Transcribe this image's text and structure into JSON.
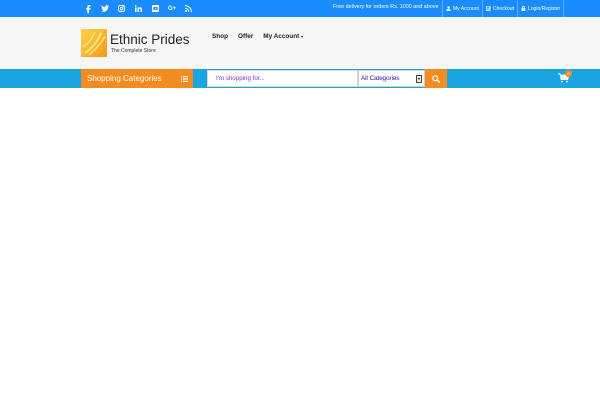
{
  "colors": {
    "topbar": "#1a8cff",
    "header_bg": "#f6f6f6",
    "category_bar": "#1aa4e2",
    "accent_orange": "#f48b20"
  },
  "topbar": {
    "social_icons": [
      "facebook-icon",
      "twitter-icon",
      "instagram-icon",
      "linkedin-icon",
      "youtube-icon",
      "google-plus-icon",
      "rss-icon"
    ],
    "google_plus_label": "G+",
    "promo": "Free delivery for orders Rs. 1000 and above",
    "links": [
      {
        "label": "My Account",
        "icon": "user-icon"
      },
      {
        "label": "Checkout",
        "icon": "checkbox-icon"
      },
      {
        "label": "Login/Register",
        "icon": "lock-icon"
      }
    ]
  },
  "header": {
    "logo_title": "Ethnic Prides",
    "logo_subtitle": "The Complete Store",
    "nav": [
      {
        "label": "Shop"
      },
      {
        "label": "Offer"
      },
      {
        "label": "My Account",
        "dropdown": true
      }
    ]
  },
  "category_bar": {
    "categories_label": "Shopping Categories",
    "categories_icon": "list-icon",
    "search_placeholder": "I'm shopping for...",
    "search_value": "",
    "select_value": "All Categories",
    "search_icon": "search-icon",
    "cart_icon": "cart-icon",
    "cart_count": "0"
  }
}
